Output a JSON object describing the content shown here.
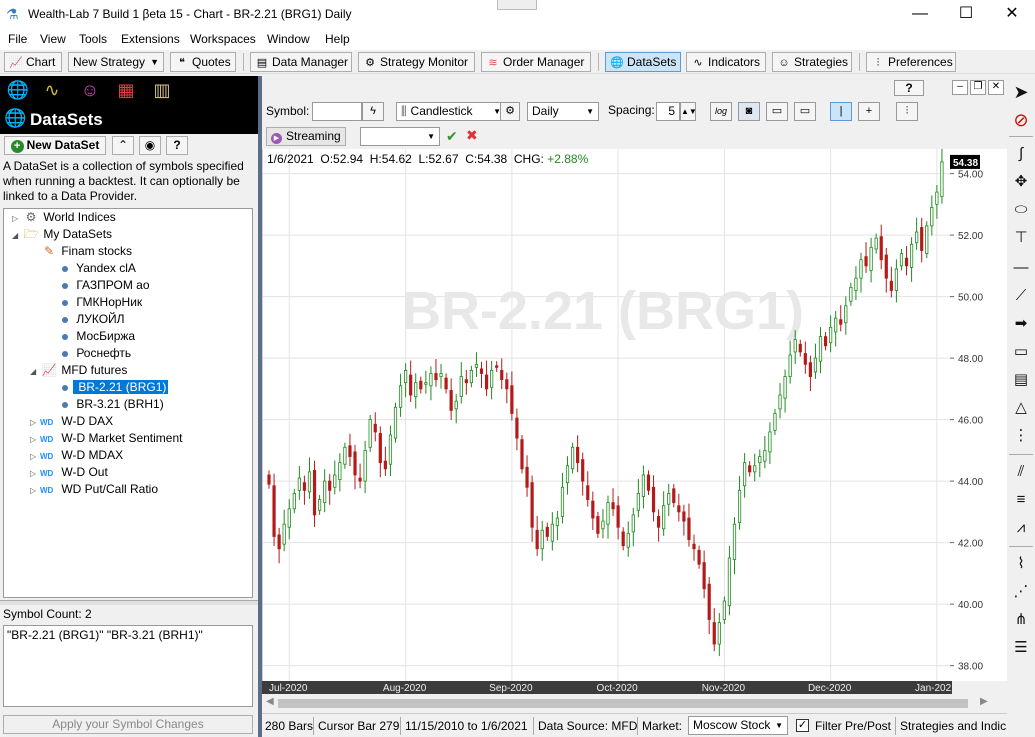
{
  "window": {
    "title": "Wealth-Lab 7 Build 1 βeta 15 - Chart - BR-2.21 (BRG1) Daily",
    "controls": [
      "—",
      "☐",
      "✕"
    ]
  },
  "menu": [
    "File",
    "View",
    "Tools",
    "Extensions",
    "Workspaces",
    "Window",
    "Help"
  ],
  "toolbar": {
    "chart": "Chart",
    "new_strategy": "New Strategy",
    "quotes": "Quotes",
    "data_manager": "Data Manager",
    "strategy_monitor": "Strategy Monitor",
    "order_manager": "Order Manager",
    "datasets": "DataSets",
    "indicators": "Indicators",
    "strategies": "Strategies",
    "preferences": "Preferences"
  },
  "left_panel": {
    "title": "DataSets",
    "new_dataset": "New DataSet",
    "description": "A DataSet is a collection of symbols specified when running a backtest. It can optionally be linked to a Data Provider.",
    "tree": [
      {
        "label": "World Indices",
        "level": 0,
        "kind": "gear",
        "expander": "▷"
      },
      {
        "label": "My DataSets",
        "level": 0,
        "kind": "folder",
        "expander": "◢"
      },
      {
        "label": "Finam stocks",
        "level": 1,
        "kind": "finam",
        "expander": ""
      },
      {
        "label": "Yandex clA",
        "level": 2,
        "kind": "dot"
      },
      {
        "label": "ГАЗПРОМ ао",
        "level": 2,
        "kind": "dot"
      },
      {
        "label": "ГМКНорНик",
        "level": 2,
        "kind": "dot"
      },
      {
        "label": "ЛУКОЙЛ",
        "level": 2,
        "kind": "dot"
      },
      {
        "label": "МосБиржа",
        "level": 2,
        "kind": "dot"
      },
      {
        "label": "Роснефть",
        "level": 2,
        "kind": "dot"
      },
      {
        "label": "MFD futures",
        "level": 1,
        "kind": "mfd",
        "expander": "◢"
      },
      {
        "label": "BR-2.21 (BRG1)",
        "level": 2,
        "kind": "dot",
        "selected": true
      },
      {
        "label": "BR-3.21 (BRH1)",
        "level": 2,
        "kind": "dot"
      },
      {
        "label": "W-D DAX",
        "level": 1,
        "kind": "wd",
        "expander": "▷"
      },
      {
        "label": "W-D Market Sentiment",
        "level": 1,
        "kind": "wd",
        "expander": "▷"
      },
      {
        "label": "W-D MDAX",
        "level": 1,
        "kind": "wd",
        "expander": "▷"
      },
      {
        "label": "W-D Out",
        "level": 1,
        "kind": "wd",
        "expander": "▷"
      },
      {
        "label": "WD Put/Call Ratio",
        "level": 1,
        "kind": "wd",
        "expander": "▷"
      }
    ],
    "symbol_count": "Symbol Count: 2",
    "symbols_text": "\"BR-2.21 (BRG1)\" \"BR-3.21 (BRH1)\"",
    "apply": "Apply your Symbol Changes"
  },
  "chart_toolbar": {
    "symbol_label": "Symbol:",
    "symbol_value": "",
    "chart_type": "Candlestick",
    "scale": "Daily",
    "spacing_label": "Spacing:",
    "spacing_value": "5",
    "log_label": "log",
    "streaming": "Streaming",
    "help": "?"
  },
  "chart_info": {
    "date": "1/6/2021",
    "o": "O:52.94",
    "h": "H:54.62",
    "l": "L:52.67",
    "c": "C:54.38",
    "chg_label": "CHG:",
    "chg_value": "+2.88%",
    "watermark": "BR-2.21 (BRG1)",
    "last_price": "54.38",
    "colors": {
      "up": "#1f8c1f",
      "down": "#b51a1a",
      "last_price_bg": "#000000",
      "chg": "#1f8c1f"
    }
  },
  "chart_data": {
    "type": "candlestick",
    "title": "BR-2.21 (BRG1)",
    "ylim": [
      37.5,
      54.8
    ],
    "yticks": [
      38.0,
      40.0,
      42.0,
      44.0,
      46.0,
      48.0,
      50.0,
      52.0,
      54.0
    ],
    "xticks": [
      "Jul-2020",
      "Aug-2020",
      "Sep-2020",
      "Oct-2020",
      "Nov-2020",
      "Dec-2020",
      "Jan-2021"
    ],
    "xtick_bar_index": [
      4,
      27,
      48,
      69,
      90,
      111,
      132
    ],
    "closes": [
      43.9,
      42.2,
      41.8,
      42.6,
      43.1,
      43.6,
      44.1,
      43.7,
      44.3,
      42.9,
      43.4,
      44.0,
      43.7,
      44.2,
      44.6,
      45.1,
      44.8,
      44.2,
      44.0,
      45.0,
      46.0,
      45.6,
      44.6,
      44.4,
      45.5,
      46.4,
      47.1,
      47.6,
      46.8,
      47.2,
      47.0,
      47.2,
      47.5,
      47.3,
      47.5,
      47.0,
      46.3,
      46.6,
      47.4,
      47.2,
      47.6,
      47.8,
      47.5,
      47.0,
      47.6,
      47.7,
      47.3,
      47.0,
      46.2,
      45.4,
      44.4,
      43.8,
      42.5,
      41.8,
      42.4,
      42.2,
      42.6,
      42.8,
      43.8,
      44.5,
      45.1,
      44.6,
      44.0,
      43.4,
      42.8,
      42.3,
      42.7,
      43.3,
      43.1,
      42.5,
      41.9,
      42.3,
      42.9,
      43.6,
      44.2,
      43.7,
      43.0,
      42.5,
      43.2,
      43.6,
      43.3,
      43.0,
      42.7,
      42.1,
      41.8,
      41.3,
      40.5,
      39.5,
      38.7,
      39.4,
      40.1,
      41.5,
      42.6,
      43.7,
      44.6,
      44.3,
      44.5,
      44.8,
      45.0,
      45.6,
      46.2,
      46.8,
      47.4,
      48.1,
      48.6,
      48.2,
      47.8,
      47.4,
      48.0,
      48.7,
      48.4,
      49.0,
      49.3,
      49.1,
      49.7,
      50.3,
      50.6,
      51.2,
      51.0,
      51.6,
      51.9,
      51.2,
      50.6,
      50.2,
      50.9,
      51.4,
      51.0,
      51.7,
      52.1,
      51.5,
      52.3,
      52.9,
      53.4,
      54.38
    ]
  }
}
